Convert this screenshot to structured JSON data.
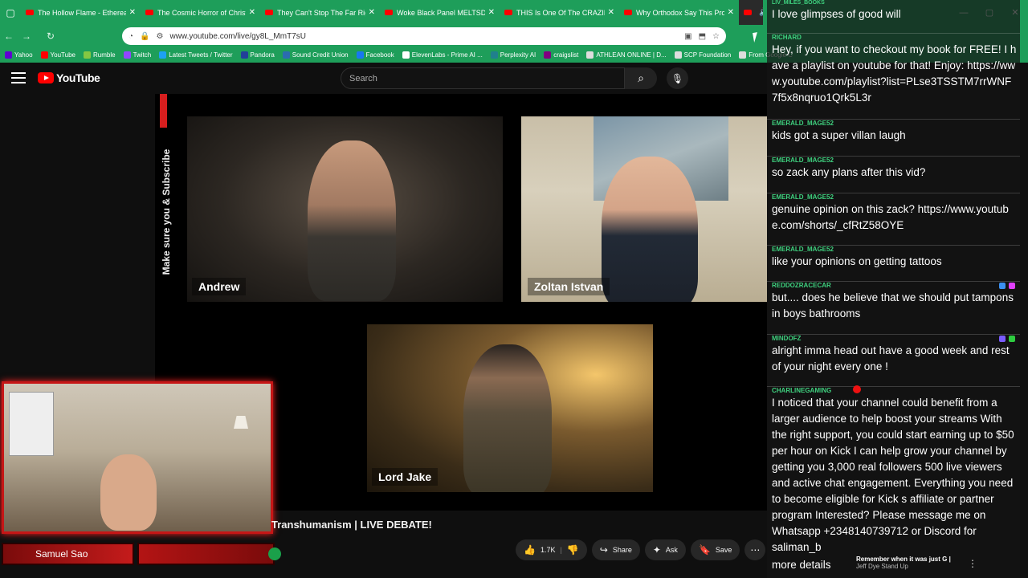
{
  "browser": {
    "tabs": [
      {
        "label": "The Hollow Flame - Ethereal Da"
      },
      {
        "label": "The Cosmic Horror of Christian"
      },
      {
        "label": "They Can't Stop The Far Right -"
      },
      {
        "label": "Woke Black Panel MELTSDOWN"
      },
      {
        "label": "THIS Is One Of The CRAZIEST Ti"
      },
      {
        "label": "Why Orthodox Say This Protest"
      }
    ],
    "url": "www.youtube.com/live/gy8L_MmT7sU",
    "bookmarks": [
      {
        "label": "Yahoo",
        "color": "#5f01d1"
      },
      {
        "label": "YouTube",
        "color": "#ff0000"
      },
      {
        "label": "Rumble",
        "color": "#85c742"
      },
      {
        "label": "Twitch",
        "color": "#9146ff"
      },
      {
        "label": "Latest Tweets / Twitter",
        "color": "#1da1f2"
      },
      {
        "label": "Pandora",
        "color": "#224099"
      },
      {
        "label": "Sound Credit Union",
        "color": "#2b6cb0"
      },
      {
        "label": "Facebook",
        "color": "#1877f2"
      },
      {
        "label": "ElevenLabs - Prime AI ...",
        "color": "#ffffff"
      },
      {
        "label": "Perplexity AI",
        "color": "#20808d"
      },
      {
        "label": "craigslist",
        "color": "#800080"
      },
      {
        "label": "ATHLEAN ONLINE | D...",
        "color": "#dddddd"
      },
      {
        "label": "SCP Foundation",
        "color": "#dddddd"
      },
      {
        "label": "From Google C",
        "color": "#dddddd"
      }
    ]
  },
  "youtube": {
    "logo_text": "YouTube",
    "search_placeholder": "Search",
    "subscribe_overlay": "Make sure you   & Subscribe",
    "participants": [
      "Andrew",
      "Zoltan Istvan",
      "Lord Jake"
    ],
    "video_title": "Transhumanism | LIVE DEBATE!",
    "actions": {
      "likes": "1.7K",
      "share": "Share",
      "ask": "Ask",
      "save": "Save"
    }
  },
  "streamer": {
    "name": "Samuel Sao"
  },
  "chat": {
    "messages": [
      {
        "user": "LIV_MILES_BOOKS",
        "text": "I love glimpses of good will"
      },
      {
        "user": "RICHARD",
        "text": "Hey, if you want to checkout my book for FREE! I have a playlist on youtube for that! Enjoy: https://www.youtube.com/playlist?list=PLse3TSSTM7rrWNF7f5x8nqruo1Qrk5L3r"
      },
      {
        "user": "EMERALD_MAGE52",
        "text": "kids got a super villan laugh"
      },
      {
        "user": "EMERALD_MAGE52",
        "text": "so zack any plans after this vid?"
      },
      {
        "user": "EMERALD_MAGE52",
        "text": "genuine opinion on this zack? https://www.youtube.com/shorts/_cfRtZ58OYE"
      },
      {
        "user": "EMERALD_MAGE52",
        "text": "like your opinions on getting tattoos"
      },
      {
        "user": "REDDOZRACECAR",
        "text": "but.... does he believe that we should put tampons in boys bathrooms"
      },
      {
        "user": "MINDOFZ",
        "text": "alright imma head out have a good week and rest of your night every one !"
      },
      {
        "user": "CHARLINEGAMING",
        "text": "I noticed that your channel could benefit from a larger audience to help boost your streams With the right support, you could start earning up to $50 per hour on Kick I can help grow your channel by getting you 3,000 real followers 500 live viewers and active chat engagement. Everything you need to become eligible for Kick s affiliate or partner program Interested? Please message me on Whatsapp +2348140739712 or Discord for saliman_b"
      },
      {
        "user": "",
        "text": "more details"
      }
    ],
    "bottom_card": {
      "line1": "Remember when it was just G |",
      "line2": "Jeff Dye Stand Up"
    }
  },
  "colors": {
    "browser_green": "#1e9e5a",
    "accent_red": "#c61616",
    "chat_user": "#3fd17f"
  }
}
